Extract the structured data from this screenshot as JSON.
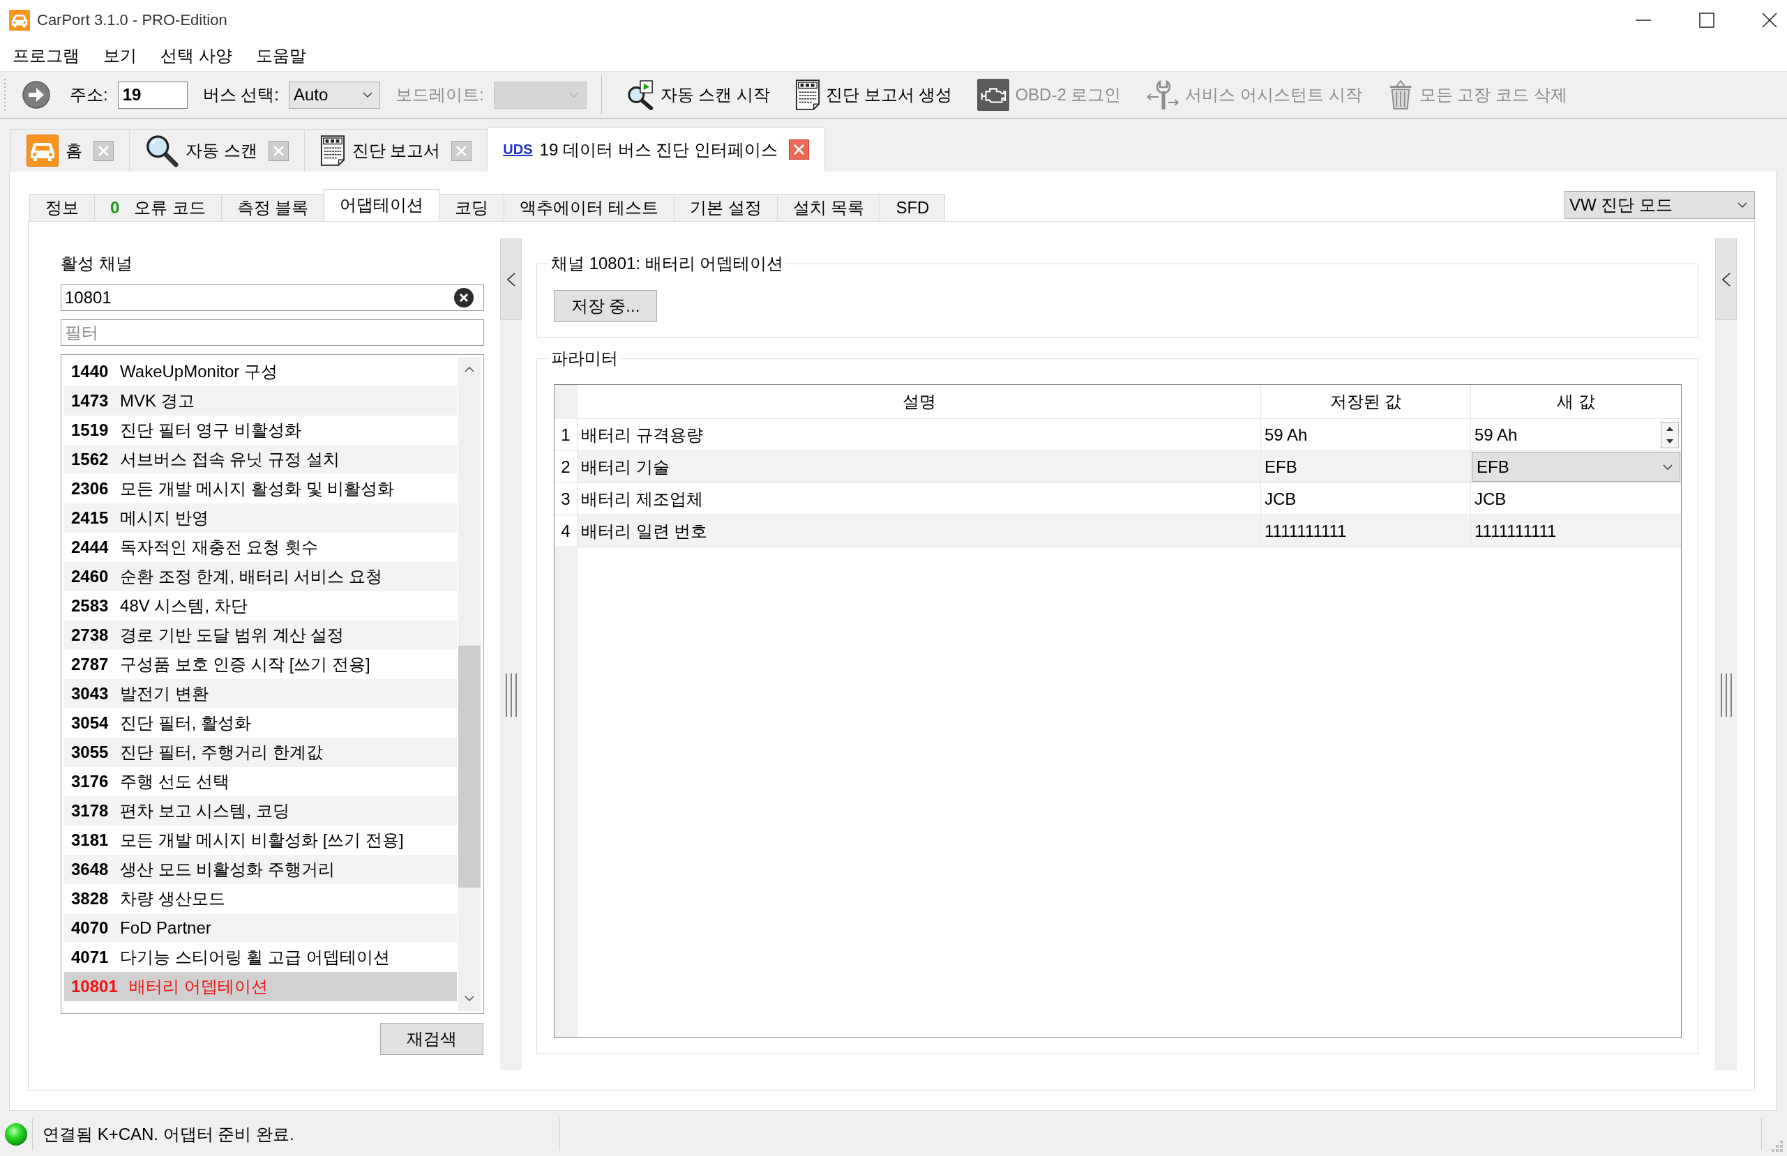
{
  "window": {
    "title": "CarPort 3.1.0 - PRO-Edition"
  },
  "menu": [
    "프로그램",
    "보기",
    "선택 사양",
    "도움말"
  ],
  "toolbar": {
    "address": {
      "label": "주소:",
      "value": "19"
    },
    "bus": {
      "label": "버스 선택:",
      "value": "Auto"
    },
    "baud": {
      "label": "보드레이트:",
      "disabled": true
    },
    "actions": [
      {
        "label": "자동 스캔 시작",
        "kind": "scan",
        "disabled": false
      },
      {
        "label": "진단 보고서 생성",
        "kind": "report",
        "disabled": false
      },
      {
        "label": "OBD-2 로그인",
        "kind": "engine",
        "disabled": true
      },
      {
        "label": "서비스 어시스턴트 시작",
        "kind": "service",
        "disabled": true
      },
      {
        "label": "모든 고장 코드 삭제",
        "kind": "delete",
        "disabled": true
      }
    ]
  },
  "doc_tabs": [
    {
      "label": "홈",
      "kind": "home",
      "selected": false
    },
    {
      "label": "자동 스캔",
      "kind": "scan",
      "selected": false
    },
    {
      "label": "진단 보고서",
      "kind": "report",
      "selected": false
    },
    {
      "prefix": "UDS",
      "label": "19 데이터 버스 진단 인터페이스",
      "kind": "uds",
      "selected": true
    }
  ],
  "sub_tabs": [
    {
      "label": "정보",
      "selected": false
    },
    {
      "count": "0",
      "label": "오류 코드",
      "selected": false
    },
    {
      "label": "측정 블록",
      "selected": false
    },
    {
      "label": "어댑테이션",
      "selected": true
    },
    {
      "label": "코딩",
      "selected": false
    },
    {
      "label": "액추에이터 테스트",
      "selected": false
    },
    {
      "label": "기본 설정",
      "selected": false
    },
    {
      "label": "설치 목록",
      "selected": false
    },
    {
      "label": "SFD",
      "selected": false
    }
  ],
  "mode_select": {
    "value": "VW 진단 모드"
  },
  "channels": {
    "title": "활성 채널",
    "value": "10801",
    "filter_placeholder": "필터",
    "items": [
      {
        "code": "1440",
        "name": "WakeUpMonitor 구성",
        "selected": false
      },
      {
        "code": "1473",
        "name": "MVK 경고",
        "selected": false
      },
      {
        "code": "1519",
        "name": "진단 필터 영구 비활성화",
        "selected": false
      },
      {
        "code": "1562",
        "name": "서브버스 접속 유닛 규정 설치",
        "selected": false
      },
      {
        "code": "2306",
        "name": "모든 개발 메시지 활성화 및 비활성화",
        "selected": false
      },
      {
        "code": "2415",
        "name": "메시지 반영",
        "selected": false
      },
      {
        "code": "2444",
        "name": "독자적인 재충전 요청 횟수",
        "selected": false
      },
      {
        "code": "2460",
        "name": "순환 조정 한계, 배터리 서비스 요청",
        "selected": false
      },
      {
        "code": "2583",
        "name": "48V 시스템, 차단",
        "selected": false
      },
      {
        "code": "2738",
        "name": "경로 기반 도달 범위 계산 설정",
        "selected": false
      },
      {
        "code": "2787",
        "name": "구성품 보호 인증 시작 [쓰기 전용]",
        "selected": false
      },
      {
        "code": "3043",
        "name": "발전기 변환",
        "selected": false
      },
      {
        "code": "3054",
        "name": "진단 필터, 활성화",
        "selected": false
      },
      {
        "code": "3055",
        "name": "진단 필터, 주행거리 한계값",
        "selected": false
      },
      {
        "code": "3176",
        "name": "주행 선도 선택",
        "selected": false
      },
      {
        "code": "3178",
        "name": "편차 보고 시스템, 코딩",
        "selected": false
      },
      {
        "code": "3181",
        "name": "모든 개발 메시지 비활성화 [쓰기 전용]",
        "selected": false
      },
      {
        "code": "3648",
        "name": "생산 모드 비활성화 주행거리",
        "selected": false
      },
      {
        "code": "3828",
        "name": "차량 생산모드",
        "selected": false
      },
      {
        "code": "4070",
        "name": "FoD Partner",
        "selected": false
      },
      {
        "code": "4071",
        "name": "다기능 스티어링 휠 고급 어뎁테이션",
        "selected": false
      },
      {
        "code": "10801",
        "name": "배터리 어뎁테이션",
        "selected": true
      }
    ],
    "rescan_button": "재검색"
  },
  "channel_group": {
    "title": "채널 10801: 배터리 어뎁테이션",
    "save_button": "저장 중..."
  },
  "parameters": {
    "title": "파라미터",
    "columns": [
      "설명",
      "저장된 값",
      "새 값"
    ],
    "rows": [
      {
        "index": "1",
        "description": "배터리 규격용량",
        "stored": "59 Ah",
        "new": "59 Ah",
        "kind": "spin"
      },
      {
        "index": "2",
        "description": "배터리 기술",
        "stored": "EFB",
        "new": "EFB",
        "kind": "select"
      },
      {
        "index": "3",
        "description": "배터리 제조업체",
        "stored": "JCB",
        "new": "JCB",
        "kind": "text"
      },
      {
        "index": "4",
        "description": "배터리 일련 번호",
        "stored": "1111111111",
        "new": "1111111111",
        "kind": "text"
      }
    ]
  },
  "status_bar": {
    "text": "연결됨 K+CAN. 어댑터 준비 완료.",
    "connected": true
  }
}
